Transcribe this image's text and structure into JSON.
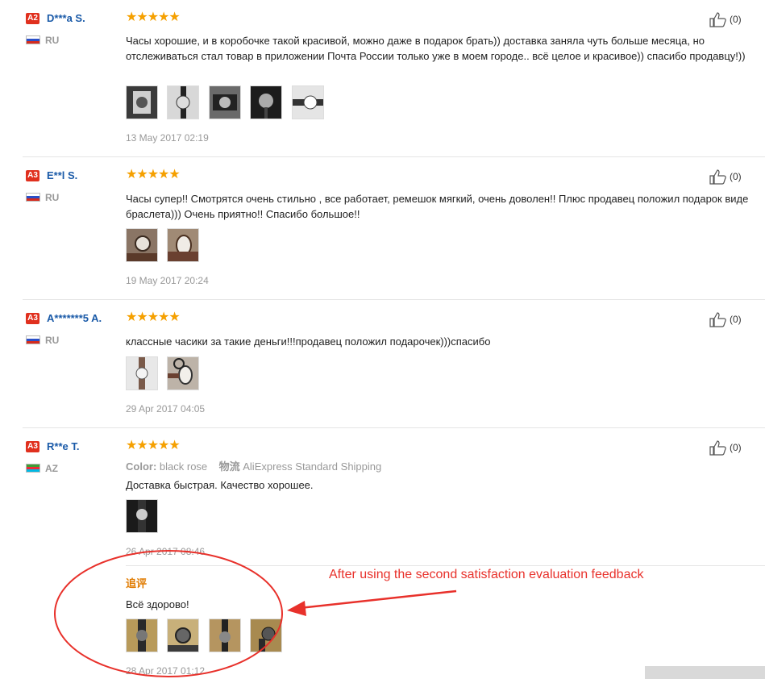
{
  "reviews": [
    {
      "badge": "A2",
      "user": "D***a S.",
      "country": "RU",
      "stars": "★★★★★",
      "likes": "(0)",
      "text": "Часы хорошие, и в коробочке такой красивой, можно даже в подарок брать)) доставка заняла чуть больше месяца, но отслеживаться стал товар в приложении Почта России только уже в моем городе.. всё целое и красивое)) спасибо продавцу!))",
      "date": "13 May 2017 02:19"
    },
    {
      "badge": "A3",
      "user": "E**l S.",
      "country": "RU",
      "stars": "★★★★★",
      "likes": "(0)",
      "text": "Часы супер!! Смотрятся очень стильно , все работает, ремешок мягкий, очень доволен!! Плюс продавец положил подарок виде браслета))) Очень приятно!! Спасибо большое!!",
      "date": "19 May 2017 20:24"
    },
    {
      "badge": "A3",
      "user": "A*******5 A.",
      "country": "RU",
      "stars": "★★★★★",
      "likes": "(0)",
      "text": "классные часики за такие деньги!!!продавец положил подарочек)))спасибо",
      "date": "29 Apr 2017 04:05"
    },
    {
      "badge": "A3",
      "user": "R**e T.",
      "country": "AZ",
      "stars": "★★★★★",
      "likes": "(0)",
      "color_label": "Color:",
      "color_value": "black rose",
      "shipping_label": "物流",
      "shipping_value": "AliExpress Standard Shipping",
      "text": "Доставка быстрая. Качество хорошее.",
      "date": "26 Apr 2017 08:46",
      "followup": {
        "label": "追评",
        "text": "Всё здорово!",
        "date": "28 Apr 2017 01:12"
      }
    }
  ],
  "annotation": "After using the second satisfaction evaluation feedback",
  "colors": {
    "accent": "#e8312b",
    "star": "#f5a000",
    "username": "#1a5aa8",
    "badge": "#e0301e"
  },
  "icons": {
    "like": "thumbs-up-icon",
    "flag": "country-flag-icon"
  }
}
